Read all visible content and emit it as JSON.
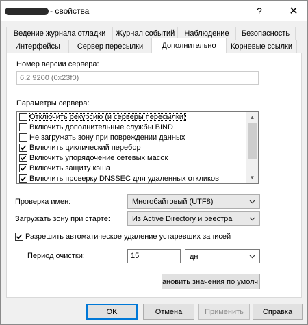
{
  "window": {
    "title_suffix": "- свойства",
    "help_glyph": "?",
    "close_glyph": "✕"
  },
  "tabs_row1": [
    "Ведение журнала отладки",
    "Журнал событий",
    "Наблюдение",
    "Безопасность"
  ],
  "tabs_row2": [
    "Интерфейсы",
    "Сервер пересылки",
    "Дополнительно",
    "Корневые ссылки"
  ],
  "active_tab": "Дополнительно",
  "advanced": {
    "server_version_label": "Номер версии сервера:",
    "server_version_value": "6.2 9200 (0x23f0)",
    "server_options_label": "Параметры сервера:",
    "server_options": [
      {
        "label": "Отключить рекурсию (и серверы пересылки)",
        "checked": false
      },
      {
        "label": "Включить дополнительные службы BIND",
        "checked": false
      },
      {
        "label": "Не загружать зону при повреждении данных",
        "checked": false
      },
      {
        "label": "Включить циклический перебор",
        "checked": true
      },
      {
        "label": "Включить упорядочение сетевых масок",
        "checked": true
      },
      {
        "label": "Включить защиту кэша",
        "checked": true
      },
      {
        "label": "Включить проверку DNSSEC для удаленных откликов",
        "checked": true
      }
    ],
    "name_check_label": "Проверка имен:",
    "name_check_value": "Многобайтовый (UTF8)",
    "load_zone_label": "Загружать зону при старте:",
    "load_zone_value": "Из Active Directory и реестра",
    "auto_scavenge_label": "Разрешить автоматическое удаление устаревших записей",
    "auto_scavenge_checked": true,
    "scavenge_period_label": "Период очистки:",
    "scavenge_period_value": "15",
    "scavenge_period_unit": "дн",
    "reset_defaults_label": "ановить значения по умолч"
  },
  "footer": {
    "ok": "OK",
    "cancel": "Отмена",
    "apply": "Применить",
    "help": "Справка"
  }
}
